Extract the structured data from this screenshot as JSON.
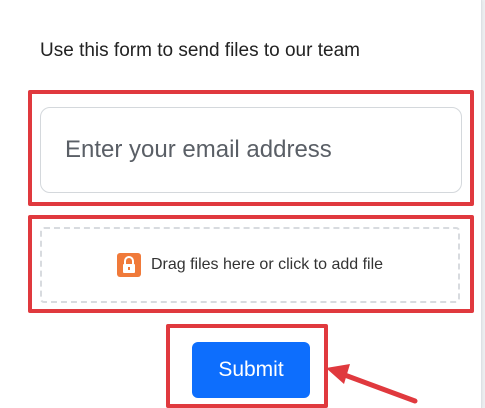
{
  "form": {
    "intro_text": "Use this form to send files to our team",
    "email_placeholder": "Enter your email address",
    "dropzone_label": "Drag files here or click to add file",
    "dropzone_icon": "lock-icon",
    "submit_label": "Submit"
  },
  "colors": {
    "accent": "#0d6efd",
    "highlight": "#e0393e",
    "lock_icon": "#f07a3a"
  }
}
